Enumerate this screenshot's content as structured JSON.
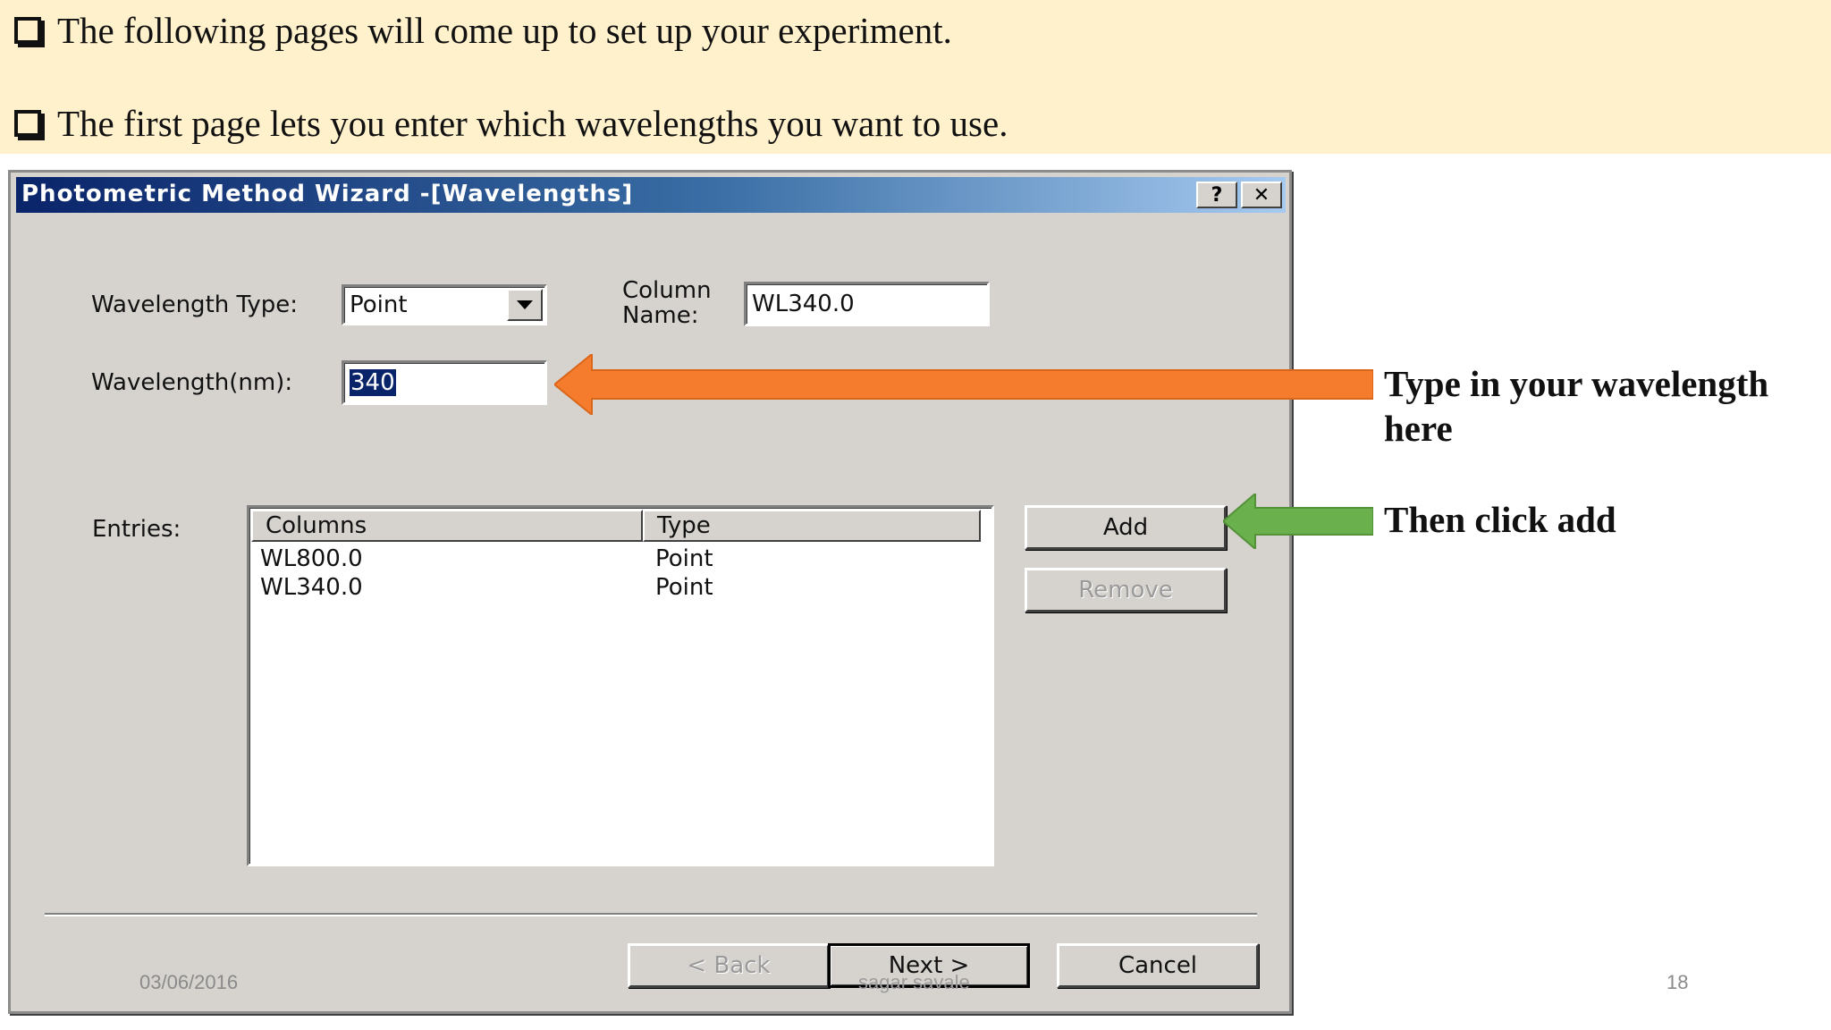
{
  "slide": {
    "bullets": [
      "The following pages will come up to set up your experiment.",
      "The first page lets you enter which wavelengths you want to use."
    ],
    "callouts": {
      "wavelength": "Type in your wavelength here",
      "add": "Then click add"
    },
    "footer": {
      "date": "03/06/2016",
      "author": "sagar savale",
      "page": "18"
    },
    "colors": {
      "banner": "#fff1cc",
      "orange_arrow": "#f47c2c",
      "green_arrow": "#6ab04c"
    }
  },
  "dialog": {
    "title": "Photometric Method Wizard -[Wavelengths]",
    "help_label": "?",
    "close_label": "✕",
    "wavelength_type": {
      "label": "Wavelength Type:",
      "value": "Point"
    },
    "column_name": {
      "label_line1": "Column",
      "label_line2": "Name:",
      "value": "WL340.0"
    },
    "wavelength_nm": {
      "label": "Wavelength(nm):",
      "value": "340"
    },
    "entries": {
      "label": "Entries:",
      "headers": [
        "Columns",
        "Type"
      ],
      "rows": [
        {
          "column": "WL800.0",
          "type": "Point"
        },
        {
          "column": "WL340.0",
          "type": "Point"
        }
      ]
    },
    "buttons": {
      "add": "Add",
      "remove": "Remove",
      "back": "< Back",
      "next": "Next >",
      "cancel": "Cancel"
    }
  }
}
